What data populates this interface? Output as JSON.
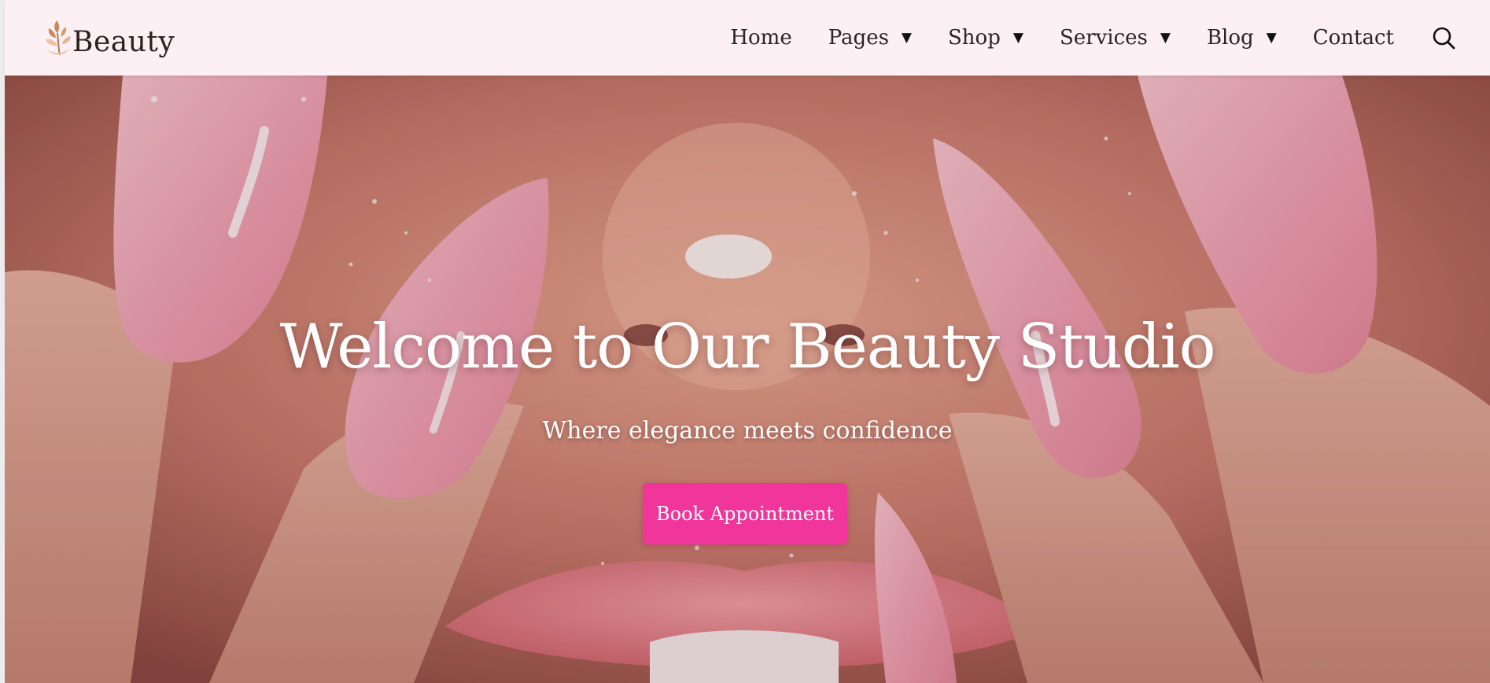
{
  "brand": {
    "name": "Beauty",
    "logo_icon": "leaf-branch-icon",
    "logo_colors": [
      "#c9875e",
      "#e9c2a6"
    ]
  },
  "nav": {
    "items": [
      {
        "label": "Home",
        "has_dropdown": false
      },
      {
        "label": "Pages",
        "has_dropdown": true
      },
      {
        "label": "Shop",
        "has_dropdown": true
      },
      {
        "label": "Services",
        "has_dropdown": true
      },
      {
        "label": "Blog",
        "has_dropdown": true
      },
      {
        "label": "Contact",
        "has_dropdown": false
      }
    ],
    "dropdown_glyph": "▼",
    "search_icon": "search-icon"
  },
  "hero": {
    "title": "Welcome to Our Beauty Studio",
    "subtitle": "Where elegance meets confidence",
    "cta_label": "Book Appointment",
    "background": "close-up of pink stiletto nails framing lips"
  },
  "colors": {
    "header_bg": "#fdf0f5",
    "accent": "#f0359b",
    "nav_text": "#2a2326",
    "hero_text": "#ffffff"
  }
}
